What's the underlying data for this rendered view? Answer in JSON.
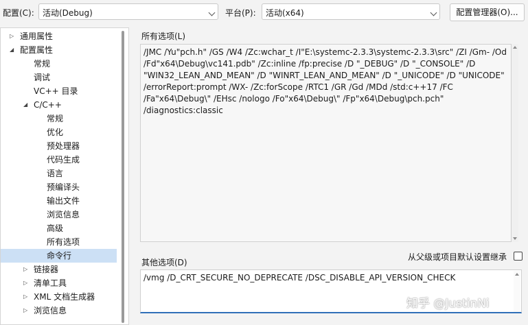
{
  "toolbar": {
    "config_label": "配置(C):",
    "config_value": "活动(Debug)",
    "platform_label": "平台(P):",
    "platform_value": "活动(x64)",
    "config_manager_button": "配置管理器(O)..."
  },
  "tree": {
    "items": [
      {
        "label": "通用属性",
        "arrow": "▷"
      },
      {
        "label": "配置属性",
        "arrow": "◢"
      },
      {
        "label": "常规"
      },
      {
        "label": "调试"
      },
      {
        "label": "VC++ 目录"
      },
      {
        "label": "C/C++",
        "arrow": "◢"
      },
      {
        "label": "常规"
      },
      {
        "label": "优化"
      },
      {
        "label": "预处理器"
      },
      {
        "label": "代码生成"
      },
      {
        "label": "语言"
      },
      {
        "label": "预编译头"
      },
      {
        "label": "输出文件"
      },
      {
        "label": "浏览信息"
      },
      {
        "label": "高级"
      },
      {
        "label": "所有选项"
      },
      {
        "label": "命令行",
        "selected": true
      },
      {
        "label": "链接器",
        "arrow": "▷"
      },
      {
        "label": "清单工具",
        "arrow": "▷"
      },
      {
        "label": "XML 文档生成器",
        "arrow": "▷"
      },
      {
        "label": "浏览信息",
        "arrow": "▷"
      }
    ]
  },
  "all_options": {
    "label": "所有选项(L)",
    "text": "/JMC /Yu\"pch.h\" /GS /W4 /Zc:wchar_t /I\"E:\\systemc-2.3.3\\systemc-2.3.3\\src\" /ZI /Gm- /Od\n/Fd\"x64\\Debug\\vc141.pdb\" /Zc:inline /fp:precise /D \"_DEBUG\" /D \"_CONSOLE\" /D\n\"WIN32_LEAN_AND_MEAN\" /D \"WINRT_LEAN_AND_MEAN\" /D \"_UNICODE\" /D \"UNICODE\"\n/errorReport:prompt /WX- /Zc:forScope /RTC1 /GR /Gd /MDd /std:c++17 /FC\n/Fa\"x64\\Debug\\\" /EHsc /nologo /Fo\"x64\\Debug\\\" /Fp\"x64\\Debug\\pch.pch\"\n/diagnostics:classic"
  },
  "inherit": {
    "label": "从父级或项目默认设置继承",
    "checked": false
  },
  "other_options": {
    "label": "其他选项(D)",
    "value": "/vmg /D_CRT_SECURE_NO_DEPRECATE /DSC_DISABLE_API_VERSION_CHECK"
  },
  "watermark": "知乎 @JustinNi"
}
